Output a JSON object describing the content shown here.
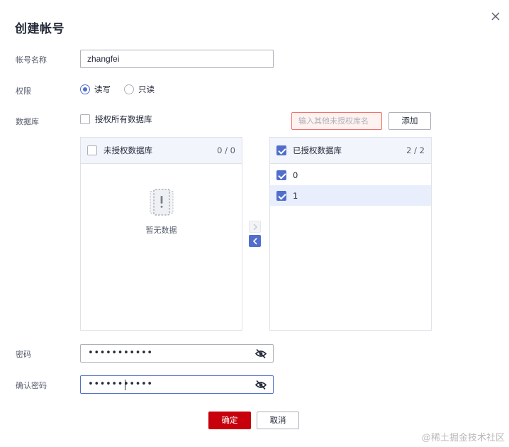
{
  "dialog": {
    "title": "创建帐号"
  },
  "account": {
    "label": "帐号名称",
    "value": "zhangfei"
  },
  "permission": {
    "label": "权限",
    "options": [
      {
        "label": "读写",
        "selected": true
      },
      {
        "label": "只读",
        "selected": false
      }
    ]
  },
  "database": {
    "label": "数据库",
    "grant_all_label": "授权所有数据库",
    "input_placeholder": "输入其他未授权库名",
    "add_label": "添加",
    "unauthorized": {
      "title": "未授权数据库",
      "count": "0 / 0",
      "empty_text": "暂无数据"
    },
    "authorized": {
      "title": "已授权数据库",
      "count": "2 / 2",
      "items": [
        "0",
        "1"
      ]
    }
  },
  "password": {
    "label": "密码",
    "masked": "•••••••••••"
  },
  "confirm_password": {
    "label": "确认密码",
    "masked": "•••••••••••"
  },
  "actions": {
    "confirm_label": "确定",
    "cancel_label": "取消"
  },
  "watermark": "@稀土掘金技术社区",
  "colors": {
    "accent": "#526ecc",
    "primary_button": "#c7000b",
    "error_border": "#f66f6a"
  }
}
